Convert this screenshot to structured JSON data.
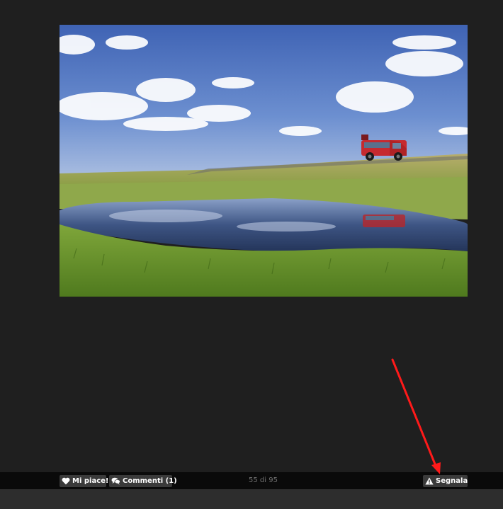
{
  "photo": {
    "alt_subject": "landscape-photo-red-van-pond"
  },
  "toolbar": {
    "like_label": "Mi piace!",
    "comments_label": "Commenti (1)",
    "counter": "55 di 95",
    "report_label": "Segnala"
  },
  "icons": {
    "like": "heart-icon",
    "comments": "speech-bubbles-icon",
    "report": "warning-triangle-icon"
  },
  "colors": {
    "page_background": "#1f1f1f",
    "toolbar_background": "#0a0a0a",
    "button_background": "#3a3a3a",
    "button_text": "#ffffff",
    "counter_text": "#6f6f6f",
    "annotation_arrow": "#ff0000"
  }
}
